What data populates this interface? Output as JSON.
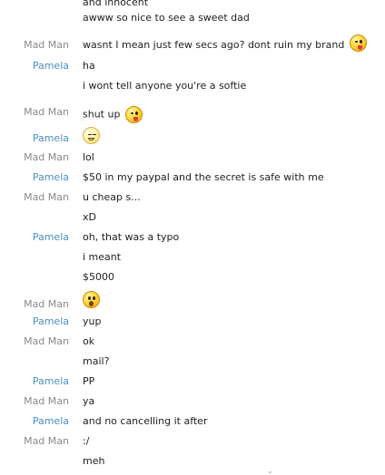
{
  "chat": {
    "senders": {
      "madman": "Mad Man",
      "pamela": "Pamela"
    },
    "messages": [
      {
        "sender": "",
        "text": "and innocent"
      },
      {
        "sender": "",
        "text": "awww so nice to see a sweet dad"
      },
      {
        "sender": "Mad Man",
        "text": "wasnt I mean just few secs ago? dont ruin my brand",
        "emoji": "tongue-out-face-icon"
      },
      {
        "sender": "Pamela",
        "text": "ha"
      },
      {
        "sender": "",
        "text": "i wont tell anyone you're a softie"
      },
      {
        "sender": "Mad Man",
        "text": "shut up",
        "emoji": "tongue-out-face-icon"
      },
      {
        "sender": "Pamela",
        "text": "",
        "emoji": "sick-face-icon"
      },
      {
        "sender": "Mad Man",
        "text": "lol"
      },
      {
        "sender": "Pamela",
        "text": "$50 in my paypal and the secret is safe with me"
      },
      {
        "sender": "Mad Man",
        "text": "u cheap s..."
      },
      {
        "sender": "",
        "text": "xD"
      },
      {
        "sender": "Pamela",
        "text": "oh, that was a typo"
      },
      {
        "sender": "",
        "text": "i meant"
      },
      {
        "sender": "",
        "text": "$5000"
      },
      {
        "sender": "Mad Man",
        "text": "",
        "emoji": "surprised-face-icon"
      },
      {
        "sender": "Pamela",
        "text": "yup"
      },
      {
        "sender": "Mad Man",
        "text": "ok"
      },
      {
        "sender": "",
        "text": "mail?"
      },
      {
        "sender": "Pamela",
        "text": "PP"
      },
      {
        "sender": "Mad Man",
        "text": "ya"
      },
      {
        "sender": "Pamela",
        "text": "and no cancelling it after"
      },
      {
        "sender": "Mad Man",
        "text": ":/"
      },
      {
        "sender": "",
        "text": "meh"
      }
    ]
  },
  "colors": {
    "madman_name": "#8a8a8a",
    "pamela_name": "#4a8fc4",
    "message_text": "#1e1e1e",
    "background": "#ffffff"
  }
}
